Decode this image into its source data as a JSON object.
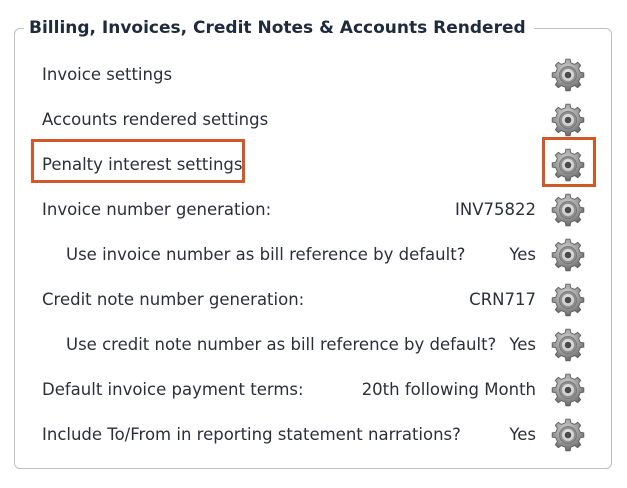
{
  "section": {
    "title": "Billing, Invoices, Credit Notes & Accounts Rendered"
  },
  "rows": [
    {
      "label": "Invoice settings",
      "value": "",
      "icon": "gear-icon"
    },
    {
      "label": "Accounts rendered settings",
      "value": "",
      "icon": "gear-icon"
    },
    {
      "label": "Penalty interest settings",
      "value": "",
      "icon": "gear-icon",
      "highlighted": true
    },
    {
      "label": "Invoice number generation:",
      "value": "INV75822",
      "icon": "gear-icon"
    },
    {
      "label": "Use invoice number as bill reference by default?",
      "value": "Yes",
      "icon": "gear-icon",
      "indented": true
    },
    {
      "label": "Credit note number generation:",
      "value": "CRN717",
      "icon": "gear-icon"
    },
    {
      "label": "Use credit note number as bill reference by default?",
      "value": "Yes",
      "icon": "gear-icon",
      "indented": true
    },
    {
      "label": "Default invoice payment terms:",
      "value": "20th following Month",
      "icon": "gear-icon"
    },
    {
      "label": "Include To/From in reporting statement narrations?",
      "value": "Yes",
      "icon": "gear-icon"
    }
  ],
  "colors": {
    "highlight": "#d2582a",
    "border": "#b9c1cb",
    "text": "#2a2f3a"
  }
}
